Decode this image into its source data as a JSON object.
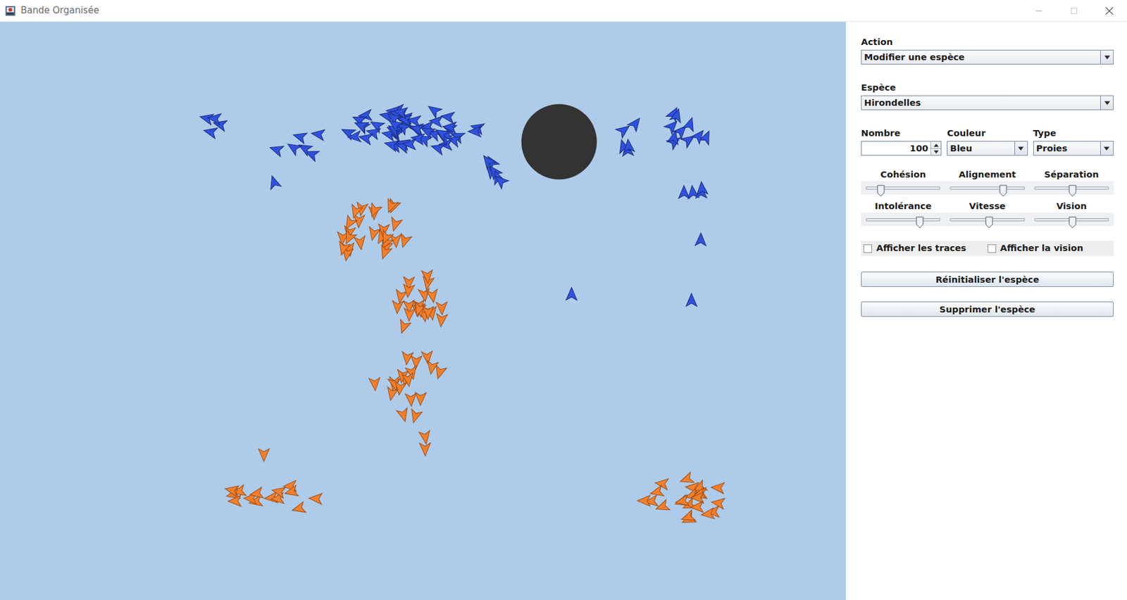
{
  "window": {
    "title": "Bande Organisée"
  },
  "form": {
    "action": {
      "label": "Action",
      "value": "Modifier une espèce"
    },
    "species": {
      "label": "Espèce",
      "value": "Hirondelles"
    },
    "fields": [
      {
        "label": "Nombre",
        "value": "100",
        "kind": "spinner"
      },
      {
        "label": "Couleur",
        "value": "Bleu",
        "kind": "combo"
      },
      {
        "label": "Type",
        "value": "Proies",
        "kind": "combo"
      }
    ],
    "sliders": [
      {
        "label": "Cohésion",
        "level": 0.19
      },
      {
        "label": "Alignement",
        "level": 0.71
      },
      {
        "label": "Séparation",
        "level": 0.51
      },
      {
        "label": "Intolérance",
        "level": 0.72
      },
      {
        "label": "Vitesse",
        "level": 0.52
      },
      {
        "label": "Vision",
        "level": 0.51
      }
    ],
    "checkboxes": [
      {
        "label": "Afficher les traces",
        "checked": false
      },
      {
        "label": "Afficher la vision",
        "checked": false
      }
    ],
    "buttons": [
      "Réinitialiser l'espèce",
      "Supprimer l'espèce"
    ]
  },
  "canvas": {
    "flocks": [
      {
        "color": "#2f52de"
      },
      {
        "color": "#f47f2a"
      }
    ]
  }
}
